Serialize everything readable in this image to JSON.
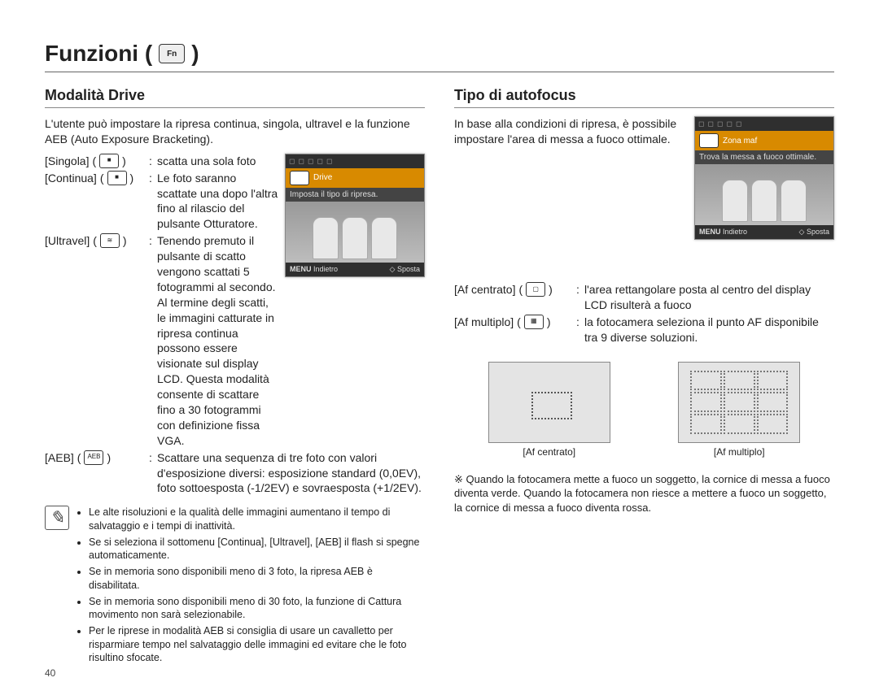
{
  "page": {
    "title": "Funzioni (",
    "title_icon": "camera-fn-icon",
    "title_close": ")",
    "number": "40"
  },
  "left": {
    "heading": "Modalità Drive",
    "intro": "L'utente può impostare la ripresa continua, singola, ultravel e la funzione AEB (Auto Exposure Bracketing).",
    "items": [
      {
        "term": "[Singola]",
        "icon": "■",
        "desc": "scatta una sola foto"
      },
      {
        "term": "[Continua]",
        "icon": "■",
        "desc": "Le foto saranno scattate una dopo l'altra fino al rilascio del pulsante Otturatore."
      },
      {
        "term": "[Ultravel]",
        "icon": "≋",
        "desc": "Tenendo premuto il pulsante di scatto vengono scattati 5 fotogrammi al secondo. Al termine degli scatti, le immagini catturate in ripresa continua possono essere visionate sul display LCD. Questa modalità consente di scattare fino a 30 fotogrammi con definizione fissa VGA."
      },
      {
        "term": "[AEB]",
        "icon": "AEB",
        "desc": "Scattare una sequenza di tre foto con valori d'esposizione diversi: esposizione standard (0,0EV), foto sottoesposta (-1/2EV) e sovraesposta (+1/2EV)."
      }
    ],
    "screenshot": {
      "menu_label": "Drive",
      "menu_sub": "Imposta il tipo di ripresa.",
      "back": "Indietro",
      "move": "Sposta"
    },
    "notes": [
      "Le alte risoluzioni e la qualità delle immagini aumentano il tempo di salvataggio e i tempi di inattività.",
      "Se si seleziona il sottomenu [Continua], [Ultravel], [AEB] il flash si spegne automaticamente.",
      "Se in memoria sono disponibili meno di 3 foto, la ripresa AEB è disabilitata.",
      "Se in memoria sono disponibili meno di 30 foto, la funzione di Cattura movimento non sarà selezionabile.",
      "Per le riprese in modalità AEB si consiglia di usare un cavalletto per risparmiare tempo nel salvataggio delle immagini ed evitare che le foto risultino sfocate."
    ]
  },
  "right": {
    "heading": "Tipo di autofocus",
    "intro": "In base alla condizioni di ripresa, è possibile impostare l'area di messa a fuoco ottimale.",
    "items": [
      {
        "term": "[Af centrato]",
        "icon": "▢",
        "desc": "l'area rettangolare posta al centro del display LCD risulterà a fuoco"
      },
      {
        "term": "[Af multiplo]",
        "icon": "▦",
        "desc": "la fotocamera seleziona il punto AF disponibile tra 9 diverse soluzioni."
      }
    ],
    "screenshot": {
      "menu_label": "Zona maf",
      "menu_sub": "Trova la messa a fuoco ottimale.",
      "back": "Indietro",
      "move": "Sposta"
    },
    "captions": {
      "center": "[Af centrato]",
      "multi": "[Af multiplo]"
    },
    "footnote": "※ Quando la fotocamera mette a fuoco un soggetto, la cornice di messa a fuoco diventa verde. Quando la fotocamera non riesce a mettere a fuoco un soggetto, la cornice di messa a fuoco diventa rossa."
  }
}
